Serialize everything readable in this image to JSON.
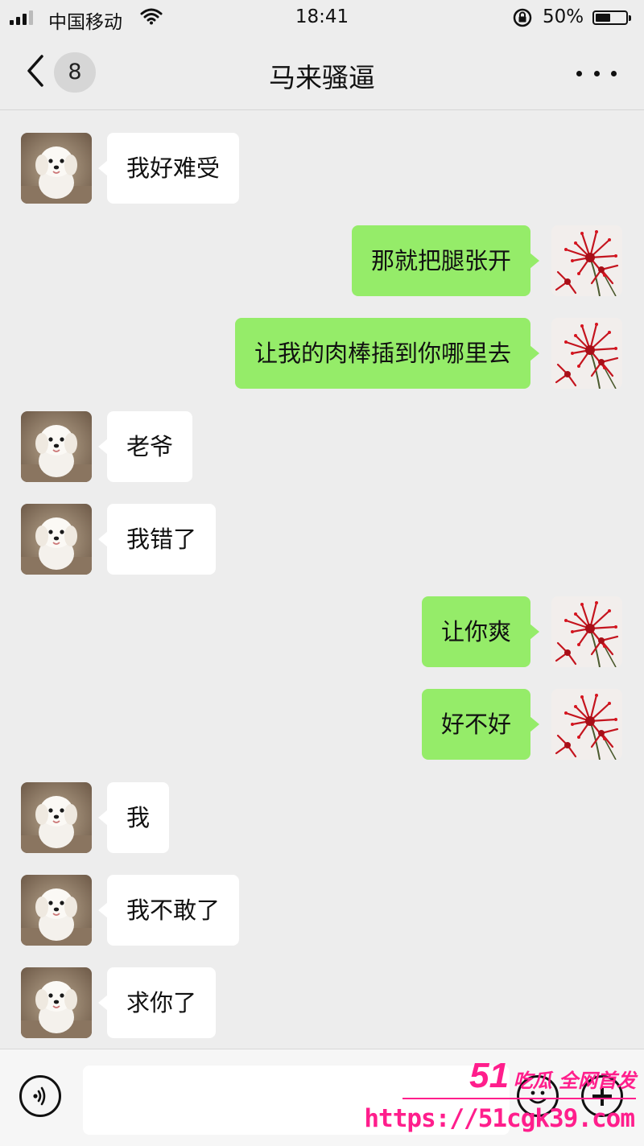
{
  "status_bar": {
    "carrier": "中国移动",
    "time": "18:41",
    "battery": "50%",
    "battery_level": 0.5
  },
  "nav": {
    "unread_count": "8",
    "title": "马来骚逼"
  },
  "messages": [
    {
      "side": "in",
      "text": "我好难受"
    },
    {
      "side": "out",
      "text": "那就把腿张开"
    },
    {
      "side": "out",
      "text": "让我的肉棒插到你哪里去"
    },
    {
      "side": "in",
      "text": "老爷"
    },
    {
      "side": "in",
      "text": "我错了"
    },
    {
      "side": "out",
      "text": "让你爽"
    },
    {
      "side": "out",
      "text": "好不好"
    },
    {
      "side": "in",
      "text": "我"
    },
    {
      "side": "in",
      "text": "我不敢了"
    },
    {
      "side": "in",
      "text": "求你了"
    }
  ],
  "input": {
    "value": "",
    "placeholder": ""
  },
  "watermark": {
    "number": "51",
    "text": "吃瓜 全网首发",
    "url": "https://51cgk39.com"
  },
  "colors": {
    "background": "#ededed",
    "incoming_bubble": "#ffffff",
    "outgoing_bubble": "#95ec69",
    "watermark": "#ff1e8c"
  }
}
